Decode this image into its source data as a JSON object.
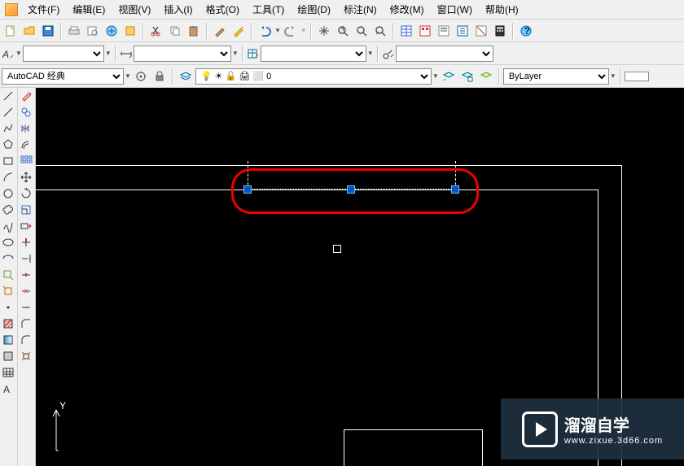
{
  "menu": {
    "file": "文件(F)",
    "edit": "编辑(E)",
    "view": "视图(V)",
    "insert": "插入(I)",
    "format": "格式(O)",
    "tools": "工具(T)",
    "draw": "绘图(D)",
    "dimension": "标注(N)",
    "modify": "修改(M)",
    "window": "窗口(W)",
    "help": "帮助(H)"
  },
  "workspace": {
    "label": "AutoCAD 经典"
  },
  "layers": {
    "current": "0",
    "bylayer": "ByLayer"
  },
  "canvas": {
    "ucs_y": "Y",
    "grip_count": 3,
    "cursor_size": 10
  },
  "watermark": {
    "title": "溜溜自学",
    "subtitle": "www.zixue.3d66.com"
  }
}
